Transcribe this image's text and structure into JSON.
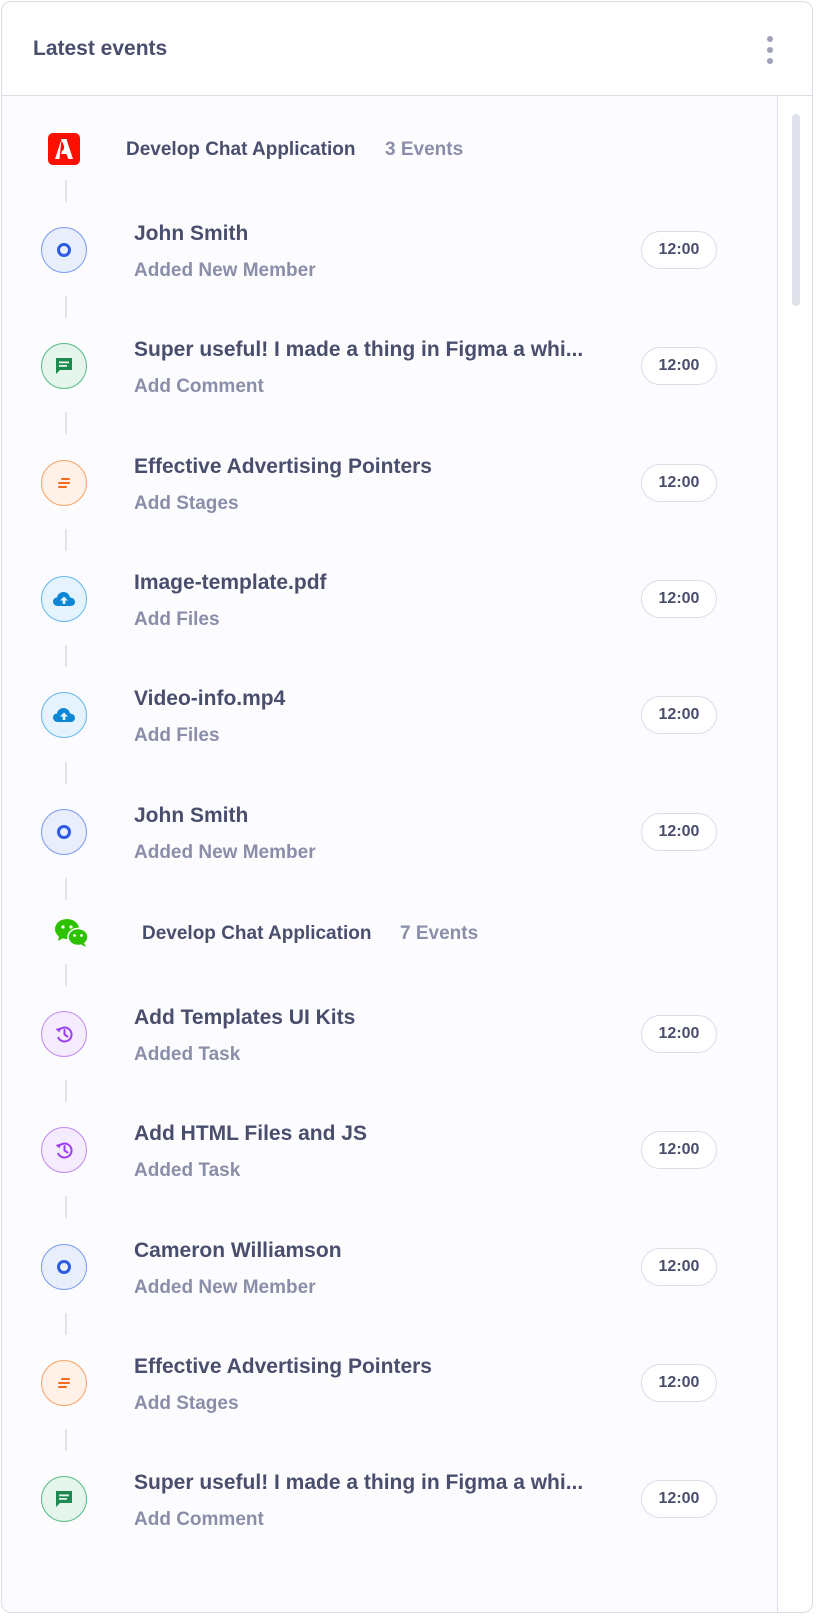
{
  "header": {
    "title": "Latest events"
  },
  "groups": [
    {
      "title": "Develop Chat Application",
      "count": "3 Events",
      "logo": "adobe-logo",
      "events": [
        {
          "icon": "member-icon",
          "title": "John Smith",
          "subtitle": "Added New Member",
          "time": "12:00"
        },
        {
          "icon": "comment-icon",
          "title": "Super useful! I made a thing in Figma a whi...",
          "subtitle": "Add Comment",
          "time": "12:00"
        },
        {
          "icon": "stages-icon",
          "title": "Effective Advertising Pointers",
          "subtitle": "Add Stages",
          "time": "12:00"
        },
        {
          "icon": "cloud-upload-icon",
          "title": "Image-template.pdf",
          "subtitle": "Add Files",
          "time": "12:00"
        },
        {
          "icon": "cloud-upload-icon",
          "title": "Video-info.mp4",
          "subtitle": "Add Files",
          "time": "12:00"
        },
        {
          "icon": "member-icon",
          "title": "John Smith",
          "subtitle": "Added New Member",
          "time": "12:00"
        }
      ]
    },
    {
      "title": "Develop Chat Application",
      "count": "7 Events",
      "logo": "wechat-logo",
      "events": [
        {
          "icon": "history-icon",
          "title": "Add Templates UI Kits",
          "subtitle": "Added Task",
          "time": "12:00"
        },
        {
          "icon": "history-icon",
          "title": "Add HTML Files and JS",
          "subtitle": "Added Task",
          "time": "12:00"
        },
        {
          "icon": "member-icon",
          "title": "Cameron Williamson",
          "subtitle": "Added New Member",
          "time": "12:00"
        },
        {
          "icon": "stages-icon",
          "title": "Effective Advertising Pointers",
          "subtitle": "Add Stages",
          "time": "12:00"
        },
        {
          "icon": "comment-icon",
          "title": "Super useful! I made a thing in Figma a whi...",
          "subtitle": "Add Comment",
          "time": "12:00"
        }
      ]
    }
  ],
  "colors": {
    "adobe_red": "#fa0f00",
    "wechat_green": "#2dc100",
    "member": "#2d5be3",
    "comment": "#1d8a4f",
    "stages": "#f26b1d",
    "files": "#0b87d6",
    "task": "#9b3ff0"
  }
}
